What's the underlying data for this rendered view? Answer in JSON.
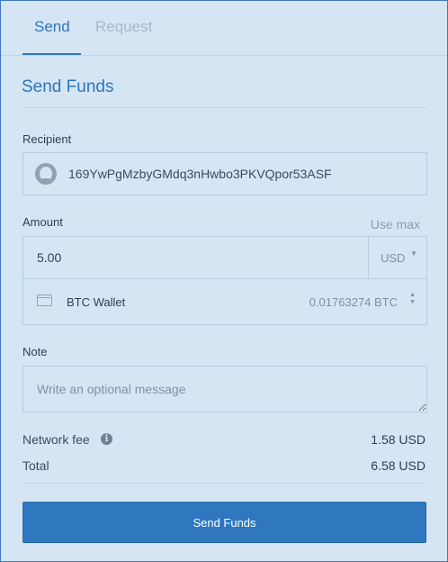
{
  "tabs": [
    {
      "label": "Send",
      "active": true
    },
    {
      "label": "Request",
      "active": false
    }
  ],
  "title": "Send Funds",
  "recipient": {
    "label": "Recipient",
    "address": "169YwPgMzbyGMdq3nHwbo3PKVQpor53ASF"
  },
  "amount": {
    "label": "Amount",
    "use_max": "Use max",
    "value": "5.00",
    "currency": "USD",
    "wallet_name": "BTC Wallet",
    "wallet_balance": "0.01763274 BTC"
  },
  "note": {
    "label": "Note",
    "placeholder": "Write an optional message"
  },
  "fee": {
    "label": "Network fee",
    "value": "1.58 USD"
  },
  "total": {
    "label": "Total",
    "value": "6.58 USD"
  },
  "submit_label": "Send Funds",
  "colors": {
    "accent": "#2b77bd",
    "background": "#d6e5f4",
    "button": "#2f77bf"
  },
  "icons": [
    "avatar-icon",
    "wallet-icon",
    "info-icon",
    "chevron-down-icon",
    "updown-icon"
  ]
}
